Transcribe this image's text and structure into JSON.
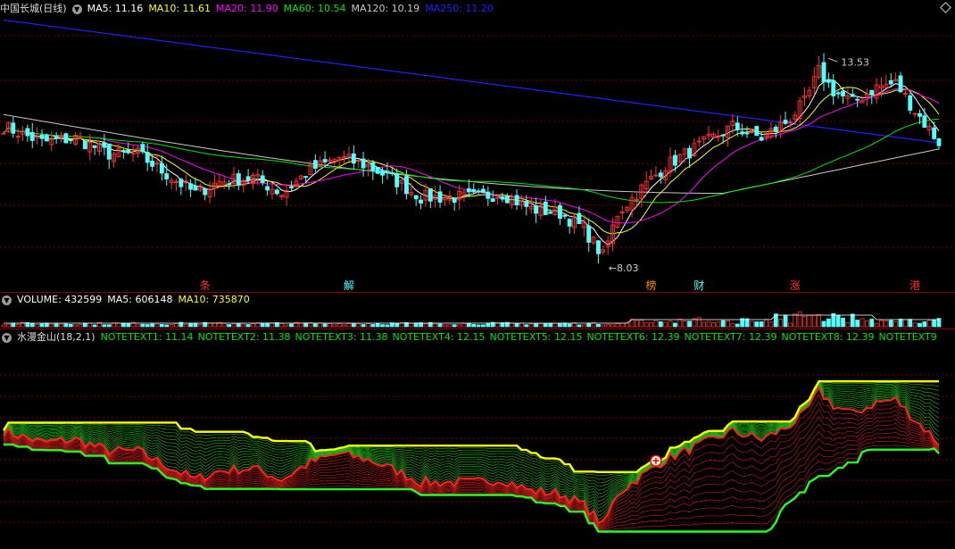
{
  "colors": {
    "up": "#ff3232",
    "down": "#54fcfc",
    "ma5": "#ffffff",
    "ma10": "#ffff00",
    "ma20": "#ff00ff",
    "ma60": "#00e600",
    "ma120": "#c8c8c8",
    "ma250": "#2020ff",
    "grid": "#7a0000",
    "note_text": "#00e600"
  },
  "main_panel": {
    "title": "中国长城(日线)",
    "ma_items": [
      {
        "label": "MA5: 11.16",
        "color": "#ffffff"
      },
      {
        "label": "MA10: 11.61",
        "color": "#ffff00"
      },
      {
        "label": "MA20: 11.90",
        "color": "#ff00ff"
      },
      {
        "label": "MA60: 10.54",
        "color": "#00e600"
      },
      {
        "label": "MA120: 10.19",
        "color": "#c8c8c8"
      },
      {
        "label": "MA250: 11.20",
        "color": "#2020ff"
      }
    ],
    "high_label": "13.53",
    "low_label": "8.03",
    "event_markers": [
      {
        "label": "条",
        "color": "#ff3232",
        "bar": 42
      },
      {
        "label": "解",
        "color": "#54fcfc",
        "bar": 72
      },
      {
        "label": "榜",
        "color": "#ff8c00",
        "bar": 135
      },
      {
        "label": "财",
        "color": "#54fcfc",
        "bar": 145
      },
      {
        "label": "涨",
        "color": "#ff3232",
        "bar": 165
      },
      {
        "label": "港",
        "color": "#ff3232",
        "bar": 190
      }
    ]
  },
  "volume_panel": {
    "items": [
      {
        "label": "VOLUME: 432599",
        "color": "#ffffff"
      },
      {
        "label": "MA5: 606148",
        "color": "#ffffff"
      },
      {
        "label": "MA10: 735870",
        "color": "#ffff00"
      }
    ]
  },
  "indicator_panel": {
    "title": "水漫金山(18,2,1)",
    "notes": [
      "NOTETEXT1: 11.14",
      "NOTETEXT2: 11.38",
      "NOTETEXT3: 11.38",
      "NOTETEXT4: 12.15",
      "NOTETEXT5: 12.15",
      "NOTETEXT6: 12.39",
      "NOTETEXT7: 12.39",
      "NOTETEXT8: 12.39",
      "NOTETEXT9"
    ]
  },
  "chart_data": {
    "type": "candlestick",
    "ylim": [
      7.6,
      14.4
    ],
    "close_anchors": [
      [
        0,
        11.6
      ],
      [
        8,
        11.2
      ],
      [
        15,
        11.3
      ],
      [
        22,
        10.9
      ],
      [
        28,
        10.9
      ],
      [
        35,
        10.3
      ],
      [
        40,
        9.9
      ],
      [
        45,
        10.2
      ],
      [
        52,
        10.3
      ],
      [
        58,
        9.9
      ],
      [
        64,
        10.5
      ],
      [
        70,
        10.8
      ],
      [
        76,
        10.6
      ],
      [
        82,
        10.2
      ],
      [
        87,
        9.8
      ],
      [
        92,
        9.8
      ],
      [
        98,
        9.8
      ],
      [
        104,
        9.9
      ],
      [
        110,
        9.5
      ],
      [
        116,
        9.4
      ],
      [
        121,
        9.0
      ],
      [
        125,
        8.3
      ],
      [
        128,
        9.4
      ],
      [
        132,
        9.9
      ],
      [
        138,
        10.6
      ],
      [
        145,
        11.1
      ],
      [
        152,
        11.6
      ],
      [
        158,
        11.3
      ],
      [
        163,
        11.7
      ],
      [
        167,
        12.2
      ],
      [
        170,
        13.0
      ],
      [
        173,
        12.5
      ],
      [
        177,
        12.2
      ],
      [
        182,
        12.6
      ],
      [
        186,
        12.7
      ],
      [
        190,
        12.0
      ],
      [
        195,
        11.2
      ]
    ],
    "high_bar": 172,
    "low_bar": 125,
    "bar_count": 196
  }
}
